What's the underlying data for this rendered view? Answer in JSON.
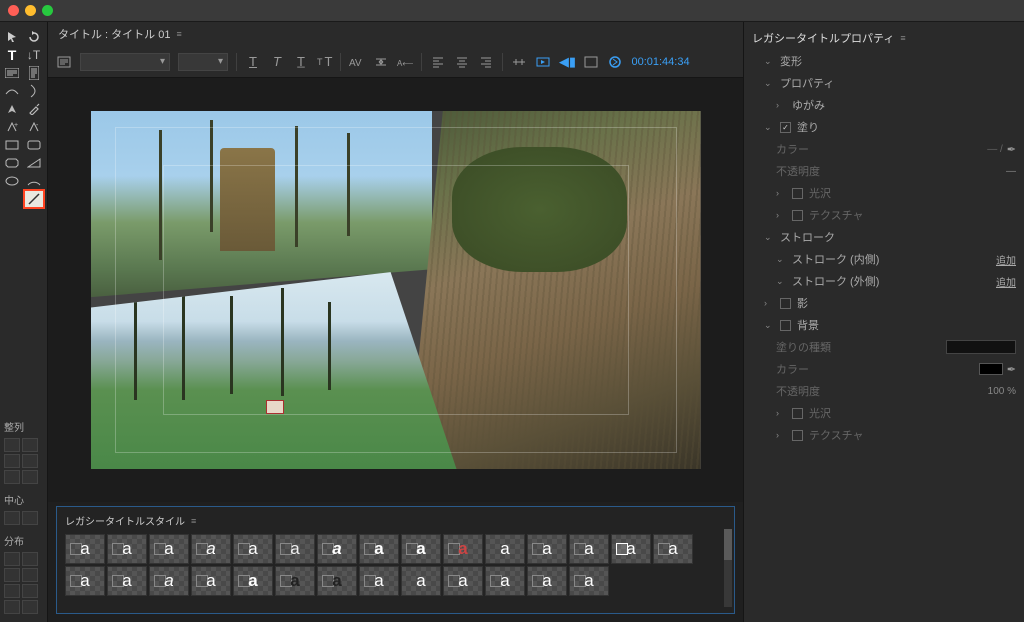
{
  "tab": {
    "title": "タイトル : タイトル 01"
  },
  "toolbar": {
    "timecode": "00:01:44:34"
  },
  "leftPanels": {
    "align": "整列",
    "center": "中心",
    "distribute": "分布"
  },
  "styles": {
    "header": "レガシータイトルスタイル",
    "swatches": [
      {
        "t": "a",
        "c": "#fff",
        "b": true,
        "w": ""
      },
      {
        "t": "a",
        "c": "#fff",
        "b": true,
        "w": ""
      },
      {
        "t": "a",
        "c": "#fff",
        "b": true,
        "w": ""
      },
      {
        "t": "a",
        "c": "#fff",
        "b": true,
        "w": "i"
      },
      {
        "t": "a",
        "c": "#fff",
        "b": true,
        "w": ""
      },
      {
        "t": "a",
        "c": "#eee",
        "b": true,
        "w": ""
      },
      {
        "t": "a",
        "c": "#fff",
        "b": true,
        "w": "i",
        "bold": true
      },
      {
        "t": "a",
        "c": "#fff",
        "b": true,
        "w": "",
        "bold": true
      },
      {
        "t": "a",
        "c": "#fff",
        "b": true,
        "w": "",
        "bold": true
      },
      {
        "t": "a",
        "c": "#c44",
        "b": true,
        "w": "",
        "bold": true
      },
      {
        "t": "a",
        "c": "#fff",
        "b": false,
        "w": ""
      },
      {
        "t": "a",
        "c": "#fff",
        "b": true,
        "w": ""
      },
      {
        "t": "a",
        "c": "#fff",
        "b": true,
        "w": ""
      },
      {
        "t": "a",
        "c": "#fff",
        "b": true,
        "w": "",
        "boxw": true
      },
      {
        "t": "a",
        "c": "#fff",
        "b": true,
        "w": ""
      },
      {
        "t": "a",
        "c": "#fff",
        "b": true,
        "w": ""
      },
      {
        "t": "a",
        "c": "#fff",
        "b": true,
        "w": ""
      },
      {
        "t": "a",
        "c": "#fff",
        "b": true,
        "w": "i"
      },
      {
        "t": "a",
        "c": "#fff",
        "b": true,
        "w": ""
      },
      {
        "t": "a",
        "c": "#fff",
        "b": true,
        "w": "",
        "bold": true
      },
      {
        "t": "a",
        "c": "#222",
        "b": true,
        "w": "",
        "bold": true
      },
      {
        "t": "a",
        "c": "#222",
        "b": true,
        "w": "",
        "bold": true
      },
      {
        "t": "a",
        "c": "#fff",
        "b": true,
        "w": ""
      },
      {
        "t": "a",
        "c": "#fff",
        "b": false,
        "w": "",
        "boxw": true
      },
      {
        "t": "a",
        "c": "#fff",
        "b": true,
        "w": ""
      },
      {
        "t": "a",
        "c": "#fff",
        "b": true,
        "w": ""
      },
      {
        "t": "a",
        "c": "#fff",
        "b": true,
        "w": ""
      },
      {
        "t": "a",
        "c": "#fff",
        "b": true,
        "w": ""
      }
    ]
  },
  "properties": {
    "header": "レガシータイトルプロパティ",
    "transform": "変形",
    "propertiesGroup": "プロパティ",
    "distortion": "ゆがみ",
    "fill": "塗り",
    "color": "カラー",
    "opacity": "不透明度",
    "sheen": "光沢",
    "texture": "テクスチャ",
    "strokes": "ストローク",
    "strokeInner": "ストローク (内側)",
    "strokeOuter": "ストローク (外側)",
    "add": "追加",
    "shadow": "影",
    "background": "背景",
    "fillType": "塗りの種類",
    "opacityVal": "100 %"
  }
}
